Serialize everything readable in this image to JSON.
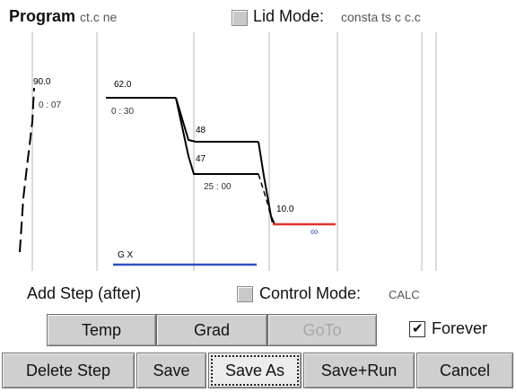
{
  "header": {
    "program_label": "Program",
    "program_name": "ct.c  ne",
    "lid_mode_label": "Lid Mode:",
    "lid_mode_value": "consta  ts  c c.c"
  },
  "graph": {
    "initial_temp": "90.0",
    "initial_time": "0  :  07",
    "step1_temp": "62.0",
    "step1_time": "0  :  30",
    "step2_temp": "48",
    "step3_temp": "47",
    "step3_time": "25 : 00",
    "hold_temp": "10.0",
    "hold_time": "∞",
    "goto_label": "G     X"
  },
  "controls": {
    "add_step_label": "Add Step (after)",
    "control_mode_label": "Control Mode:",
    "control_mode_value": "CALC",
    "forever_label": "Forever",
    "forever_checked": true
  },
  "step_buttons": {
    "temp": "Temp",
    "grad": "Grad",
    "goto": "GoTo"
  },
  "action_buttons": {
    "delete_step": "Delete Step",
    "save": "Save",
    "save_as": "Save As",
    "save_run": "Save+Run",
    "cancel": "Cancel"
  },
  "colors": {
    "step_line": "#000000",
    "hold_line": "#e03030",
    "goto_line": "#3050c0",
    "infinity": "#3050c0",
    "grid": "#cccccc"
  }
}
